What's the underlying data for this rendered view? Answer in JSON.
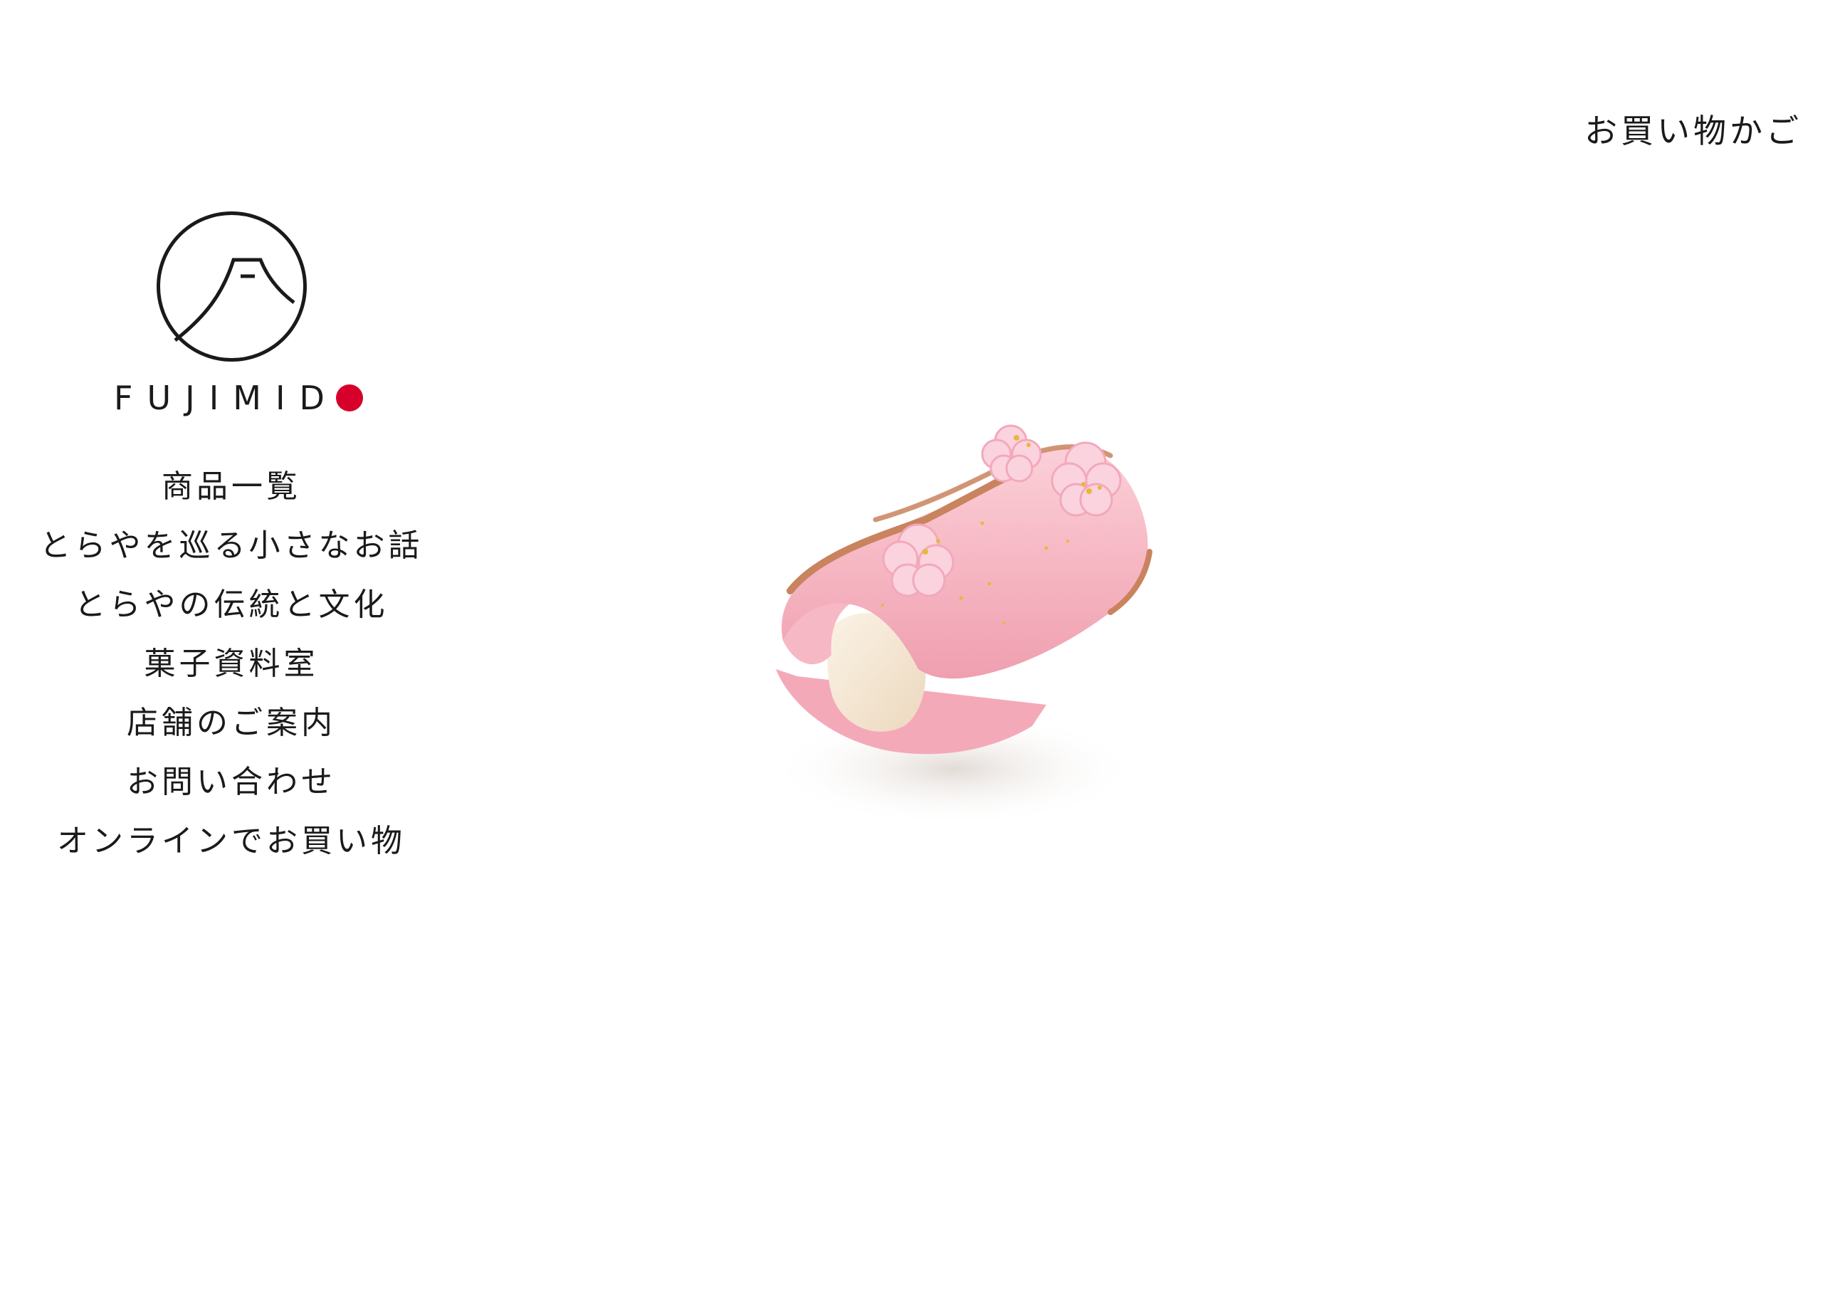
{
  "header": {
    "cart_label": "お買い物かご"
  },
  "brand": {
    "name": "FUJIMID",
    "accent_color": "#d6002a",
    "logo_icon": "mount-fuji-circle-icon"
  },
  "nav": {
    "items": [
      {
        "label": "商品一覧"
      },
      {
        "label": "とらやを巡る小さなお話"
      },
      {
        "label": "とらやの伝統と文化"
      },
      {
        "label": "菓子資料室"
      },
      {
        "label": "店舗のご案内"
      },
      {
        "label": "お問い合わせ"
      },
      {
        "label": "オンラインでお買い物"
      }
    ]
  },
  "hero": {
    "subject": "pink-wagashi-sakura-image",
    "colors": {
      "wrapper": "#f6b7c3",
      "filling": "#f7ead9",
      "rim": "#c9835e",
      "blossom": "#fbd3de",
      "gold": "#e8b838"
    }
  }
}
